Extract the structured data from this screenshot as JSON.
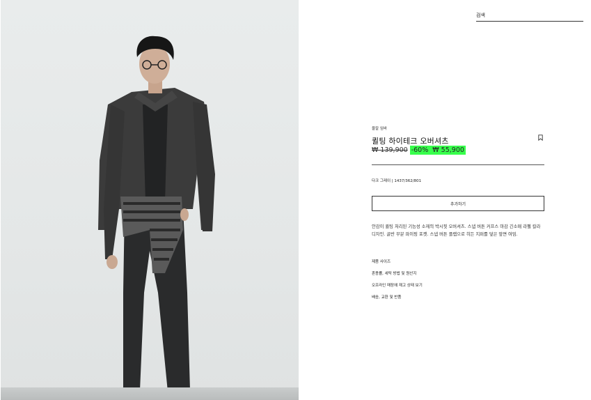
{
  "search": {
    "label": "검색"
  },
  "product": {
    "category": "울칼 임바",
    "title": "퀼팅 하이테크 오버셔츠",
    "old_price": "₩ 139,900",
    "discount": "-60%",
    "sale_price": "₩ 55,900",
    "color_ref": "다크 그레이 | 1437/362/801",
    "add_button": "추가하기",
    "description": "안감이 퀼팅 처리된 기능성 소재의 박시핏 오버셔츠. 스냅 버튼 커프스 마감 긴소매 라펠 칼라 디자인. 골반 부분 파이핑 포켓. 스냅 버튼 플랩으로 히든 지퍼를 덮은 앞면 여밈.",
    "links": [
      "제품 사이즈",
      "혼용률, 세탁 방법 및 원산지",
      "오프라인 매장에 재고 상태 보기",
      "배송, 교환 및 반품"
    ]
  },
  "colors": {
    "sale_highlight": "#38ff4c",
    "text": "#222222"
  },
  "icons": {
    "bookmark": "bookmark-icon"
  }
}
